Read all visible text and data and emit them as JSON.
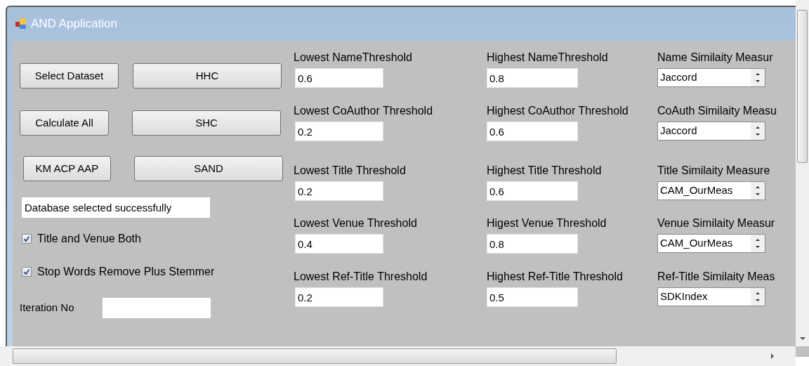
{
  "window": {
    "title": "AND Application"
  },
  "buttons": [
    {
      "label": "Select Dataset"
    },
    {
      "label": "HHC"
    },
    {
      "label": "Calculate All"
    },
    {
      "label": "SHC"
    },
    {
      "label": "KM ACP AAP"
    },
    {
      "label": "SAND"
    }
  ],
  "status_field": {
    "value": "Database selected successfully"
  },
  "checkboxes": [
    {
      "label": "Title and Venue Both",
      "checked": true
    },
    {
      "label": "Stop Words Remove Plus Stemmer",
      "checked": true
    }
  ],
  "iteration": {
    "label": "Iteration No"
  },
  "rows": [
    {
      "low_label": "Lowest NameThreshold",
      "low_value": "0.6",
      "high_label": "Highest NameThreshold",
      "high_value": "0.8",
      "measure_label": "Name Similaity Measur",
      "measure_value": "Jaccord"
    },
    {
      "low_label": "Lowest CoAuthor Threshold",
      "low_value": "0.2",
      "high_label": "Highest CoAuthor Threshold",
      "high_value": "0.6",
      "measure_label": "CoAuth Similaity Measu",
      "measure_value": "Jaccord"
    },
    {
      "low_label": "Lowest Title Threshold",
      "low_value": "0.2",
      "high_label": "Highest Title Threshold",
      "high_value": "0.6",
      "measure_label": "Title Similaity Measure",
      "measure_value": "CAM_OurMeas"
    },
    {
      "low_label": "Lowest Venue Threshold",
      "low_value": "0.4",
      "high_label": "Higest Venue Threshold",
      "high_value": "0.8",
      "measure_label": "Venue Similaity Measur",
      "measure_value": "CAM_OurMeas"
    },
    {
      "low_label": "Lowest Ref-Title Threshold",
      "low_value": "0.2",
      "high_label": "Highest Ref-Title Threshold",
      "high_value": "0.5",
      "measure_label": "Ref-Title Similaity Meas",
      "measure_value": "SDKIndex"
    }
  ]
}
